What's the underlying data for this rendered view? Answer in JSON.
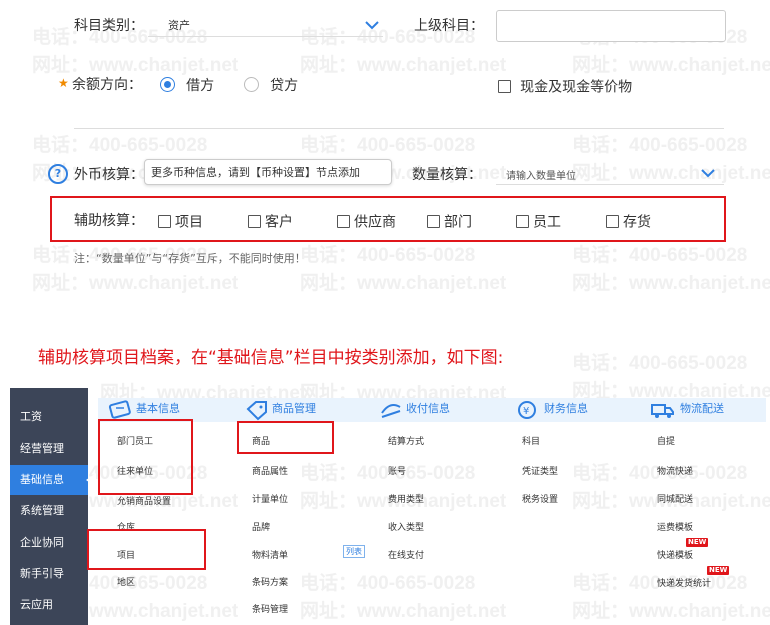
{
  "watermarks": {
    "phone": "电话：400-665-0028",
    "web": "网址：www.chanjet.net"
  },
  "form": {
    "subject_type_label": "科目类别：",
    "subject_type_value": "资产",
    "parent_subject_label": "上级科目：",
    "balance_direction_label": "余额方向：",
    "debit_label": "借方",
    "credit_label": "贷方",
    "cash_equiv_label": "现金及现金等价物",
    "foreign_currency_label": "外币核算：",
    "foreign_tooltip": "更多币种信息，请到【币种设置】节点添加",
    "quantity_label": "数量核算：",
    "quantity_placeholder": "请输入数量单位",
    "aux_label": "辅助核算：",
    "aux_options": [
      "项目",
      "客户",
      "供应商",
      "部门",
      "员工",
      "存货"
    ],
    "note": "注：“数量单位”与“存货”互斥，不能同时使用！"
  },
  "caption": "辅助核算项目档案，在“基础信息”栏目中按类别添加，如下图:",
  "app": {
    "sidebar": [
      "工资",
      "经营管理",
      "基础信息",
      "系统管理",
      "企业协同",
      "新手引导",
      "云应用"
    ],
    "sidebar_active": "基础信息",
    "categories": [
      "基本信息",
      "商品管理",
      "收付信息",
      "财务信息",
      "物流配送"
    ],
    "columns": [
      [
        "部门员工",
        "往来单位",
        "允销商品设置",
        "仓库",
        "项目",
        "地区"
      ],
      [
        "商品",
        "商品属性",
        "计量单位",
        "品牌",
        "物料清单",
        "条码方案",
        "条码管理"
      ],
      [
        "结算方式",
        "账号",
        "费用类型",
        "收入类型",
        "在线支付"
      ],
      [
        "科目",
        "凭证类型",
        "税务设置"
      ],
      [
        "自提",
        "物流快递",
        "同城配送",
        "运费模板",
        "快递模板",
        "快递发货统计"
      ]
    ],
    "list_badge": "列表",
    "new_badge": "NEW"
  }
}
